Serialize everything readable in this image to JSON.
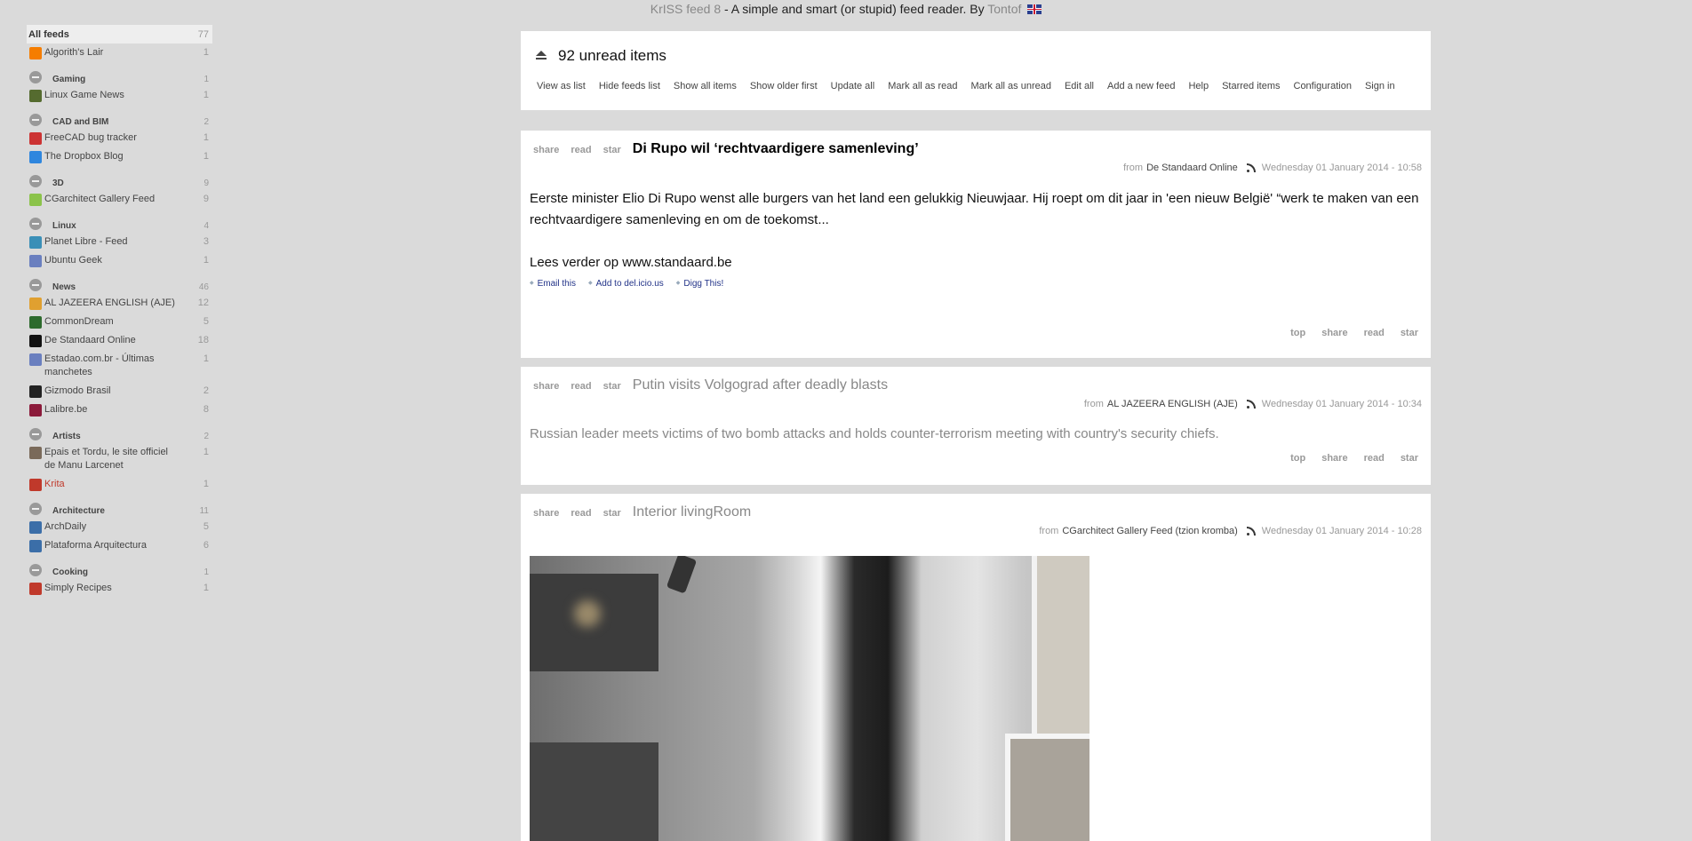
{
  "header": {
    "app_name": "KrISS feed 8",
    "tagline": " - A simple and smart (or stupid) feed reader. By ",
    "author": "Tontof"
  },
  "sidebar": {
    "all_feeds": {
      "label": "All feeds",
      "count": "77"
    },
    "ungrouped": [
      {
        "label": "Algorith's Lair",
        "count": "1",
        "icon": "blogger-icon",
        "color": "#f57d00"
      }
    ],
    "groups": [
      {
        "name": "Gaming",
        "count": "1",
        "feeds": [
          {
            "label": "Linux Game News",
            "count": "1",
            "icon": "tux-icon",
            "color": "#556b2f"
          }
        ]
      },
      {
        "name": "CAD and BIM",
        "count": "2",
        "feeds": [
          {
            "label": "FreeCAD bug tracker",
            "count": "1",
            "icon": "bug-icon",
            "color": "#cc3333"
          },
          {
            "label": "The Dropbox Blog",
            "count": "1",
            "icon": "dropbox-icon",
            "color": "#2e86de"
          }
        ]
      },
      {
        "name": "3D",
        "count": "9",
        "feeds": [
          {
            "label": "CGarchitect Gallery Feed",
            "count": "9",
            "icon": "cube-icon",
            "color": "#8bc34a"
          }
        ]
      },
      {
        "name": "Linux",
        "count": "4",
        "feeds": [
          {
            "label": "Planet Libre - Feed",
            "count": "3",
            "icon": "globe-icon",
            "color": "#3a8fb7"
          },
          {
            "label": "Ubuntu Geek",
            "count": "1",
            "icon": "ubuntu-icon",
            "color": "#6a7fbf"
          }
        ]
      },
      {
        "name": "News",
        "count": "46",
        "feeds": [
          {
            "label": "AL JAZEERA ENGLISH (AJE)",
            "count": "12",
            "icon": "aljazeera-icon",
            "color": "#e0a030"
          },
          {
            "label": "CommonDream",
            "count": "5",
            "icon": "globe-icon",
            "color": "#2d6a2d"
          },
          {
            "label": "De Standaard Online",
            "count": "18",
            "icon": "ds-icon",
            "color": "#111111"
          },
          {
            "label": "Estadao.com.br - Últimas manchetes",
            "count": "1",
            "icon": "globe-icon",
            "color": "#6a7fbf"
          },
          {
            "label": "Gizmodo Brasil",
            "count": "2",
            "icon": "g-icon",
            "color": "#222222"
          },
          {
            "label": "Lalibre.be",
            "count": "8",
            "icon": "lalibre-icon",
            "color": "#8b1a3a"
          }
        ]
      },
      {
        "name": "Artists",
        "count": "2",
        "feeds": [
          {
            "label": "Epais et Tordu, le site officiel de Manu Larcenet",
            "count": "1",
            "icon": "drawing-icon",
            "color": "#7a6a5a"
          },
          {
            "label": "Krita",
            "count": "1",
            "icon": "krita-icon",
            "color": "#c0392b"
          }
        ]
      },
      {
        "name": "Architecture",
        "count": "11",
        "feeds": [
          {
            "label": "ArchDaily",
            "count": "5",
            "icon": "archdaily-icon",
            "color": "#3b6ea8"
          },
          {
            "label": "Plataforma Arquitectura",
            "count": "6",
            "icon": "archdaily-icon",
            "color": "#3b6ea8"
          }
        ]
      },
      {
        "name": "Cooking",
        "count": "1",
        "feeds": [
          {
            "label": "Simply Recipes",
            "count": "1",
            "icon": "flower-icon",
            "color": "#c0392b"
          }
        ]
      }
    ]
  },
  "toolbar": {
    "title": "92 unread items",
    "menu": [
      "View as list",
      "Hide feeds list",
      "Show all items",
      "Show older first",
      "Update all",
      "Mark all as read",
      "Mark all as unread",
      "Edit all",
      "Add a new feed",
      "Help",
      "Starred items",
      "Configuration",
      "Sign in"
    ]
  },
  "actions": {
    "share": "share",
    "read": "read",
    "star": "star",
    "top": "top",
    "from": "from"
  },
  "articles": [
    {
      "title": "Di Rupo wil ‘rechtvaardigere samenleving’",
      "state": "unread",
      "source": "De Standaard Online",
      "date": "Wednesday 01 January 2014 - 10:58",
      "body1": "Eerste minister Elio Di Rupo wenst alle burgers van het land een gelukkig Nieuwjaar. Hij roept om dit jaar in 'een nieuw België' “werk te maken van een rechtvaardigere samenleving en om de toekomst...",
      "body2": "Lees verder op www.standaard.be",
      "links": [
        "Email this",
        "Add to del.icio.us",
        "Digg This!"
      ]
    },
    {
      "title": "Putin visits Volgograd after deadly blasts",
      "state": "read",
      "source": "AL JAZEERA ENGLISH (AJE)",
      "date": "Wednesday 01 January 2014 - 10:34",
      "body1": "Russian leader meets victims of two bomb attacks and holds counter-terrorism meeting with country's security chiefs."
    },
    {
      "title": "Interior livingRoom",
      "state": "read",
      "source": "CGarchitect Gallery Feed (tzion kromba)",
      "date": "Wednesday 01 January 2014 - 10:28"
    }
  ]
}
